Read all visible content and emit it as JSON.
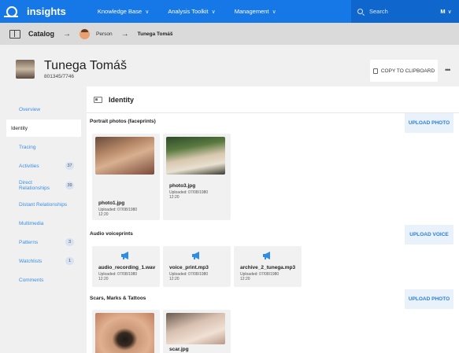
{
  "nav": {
    "brand": "insights",
    "items": [
      {
        "label": "Knowledge Base"
      },
      {
        "label": "Analysis Toolkit"
      },
      {
        "label": "Management"
      }
    ],
    "search_placeholder": "Search",
    "user_initial": "M",
    "chevron": "∨"
  },
  "breadcrumb": {
    "catalog": "Catalog",
    "arrow": "→",
    "person": "Person",
    "name": "Tunega Tomáš"
  },
  "profile": {
    "name": "Tunega Tomáš",
    "id": "801345/7746",
    "copy_label": "COPY TO CLIPBOARD",
    "more_label": "•••"
  },
  "sidebar": {
    "items": [
      {
        "label": "Overview",
        "badge": ""
      },
      {
        "label": "Identity",
        "badge": ""
      },
      {
        "label": "Tracing",
        "badge": ""
      },
      {
        "label": "Activities",
        "badge": "37"
      },
      {
        "label": "Direct Relationships",
        "badge": "39"
      },
      {
        "label": "Distant Relationships",
        "badge": ""
      },
      {
        "label": "Multimedia",
        "badge": ""
      },
      {
        "label": "Patterns",
        "badge": "3"
      },
      {
        "label": "Watchlists",
        "badge": "1"
      },
      {
        "label": "Comments",
        "badge": ""
      }
    ]
  },
  "main": {
    "title": "Identity",
    "portrait": {
      "title": "Portrait photos (faceprints)",
      "upload_label": "UPLOAD PHOTO",
      "files": [
        {
          "name": "photo1.jpg",
          "uploaded": "Uploaded: 07/08/1980",
          "time": "12:20"
        },
        {
          "name": "photo3.jpg",
          "uploaded": "Uploaded: 07/08/1980",
          "time": "12:20"
        }
      ]
    },
    "audio": {
      "title": "Audio voiceprints",
      "upload_label": "UPLOAD VOICE",
      "files": [
        {
          "name": "audio_recording_1.wav",
          "uploaded": "Uploaded: 07/08/1980",
          "time": "12:20"
        },
        {
          "name": "voice_print.mp3",
          "uploaded": "Uploaded: 07/08/1980",
          "time": "12:20"
        },
        {
          "name": "archive_2_tunega.mp3",
          "uploaded": "Uploaded: 07/08/1980",
          "time": "12:20"
        }
      ]
    },
    "scars": {
      "title": "Scars, Marks & Tattoos",
      "upload_label": "UPLOAD PHOTO",
      "files": [
        {
          "name": "",
          "uploaded": "",
          "time": ""
        },
        {
          "name": "scar.jpg",
          "uploaded": "",
          "time": ""
        }
      ]
    }
  },
  "colors": {
    "brand": "#1677e6",
    "link": "#3a8fe6",
    "upload_bg": "#e9f1fb",
    "upload_text": "#2d7fd8"
  }
}
